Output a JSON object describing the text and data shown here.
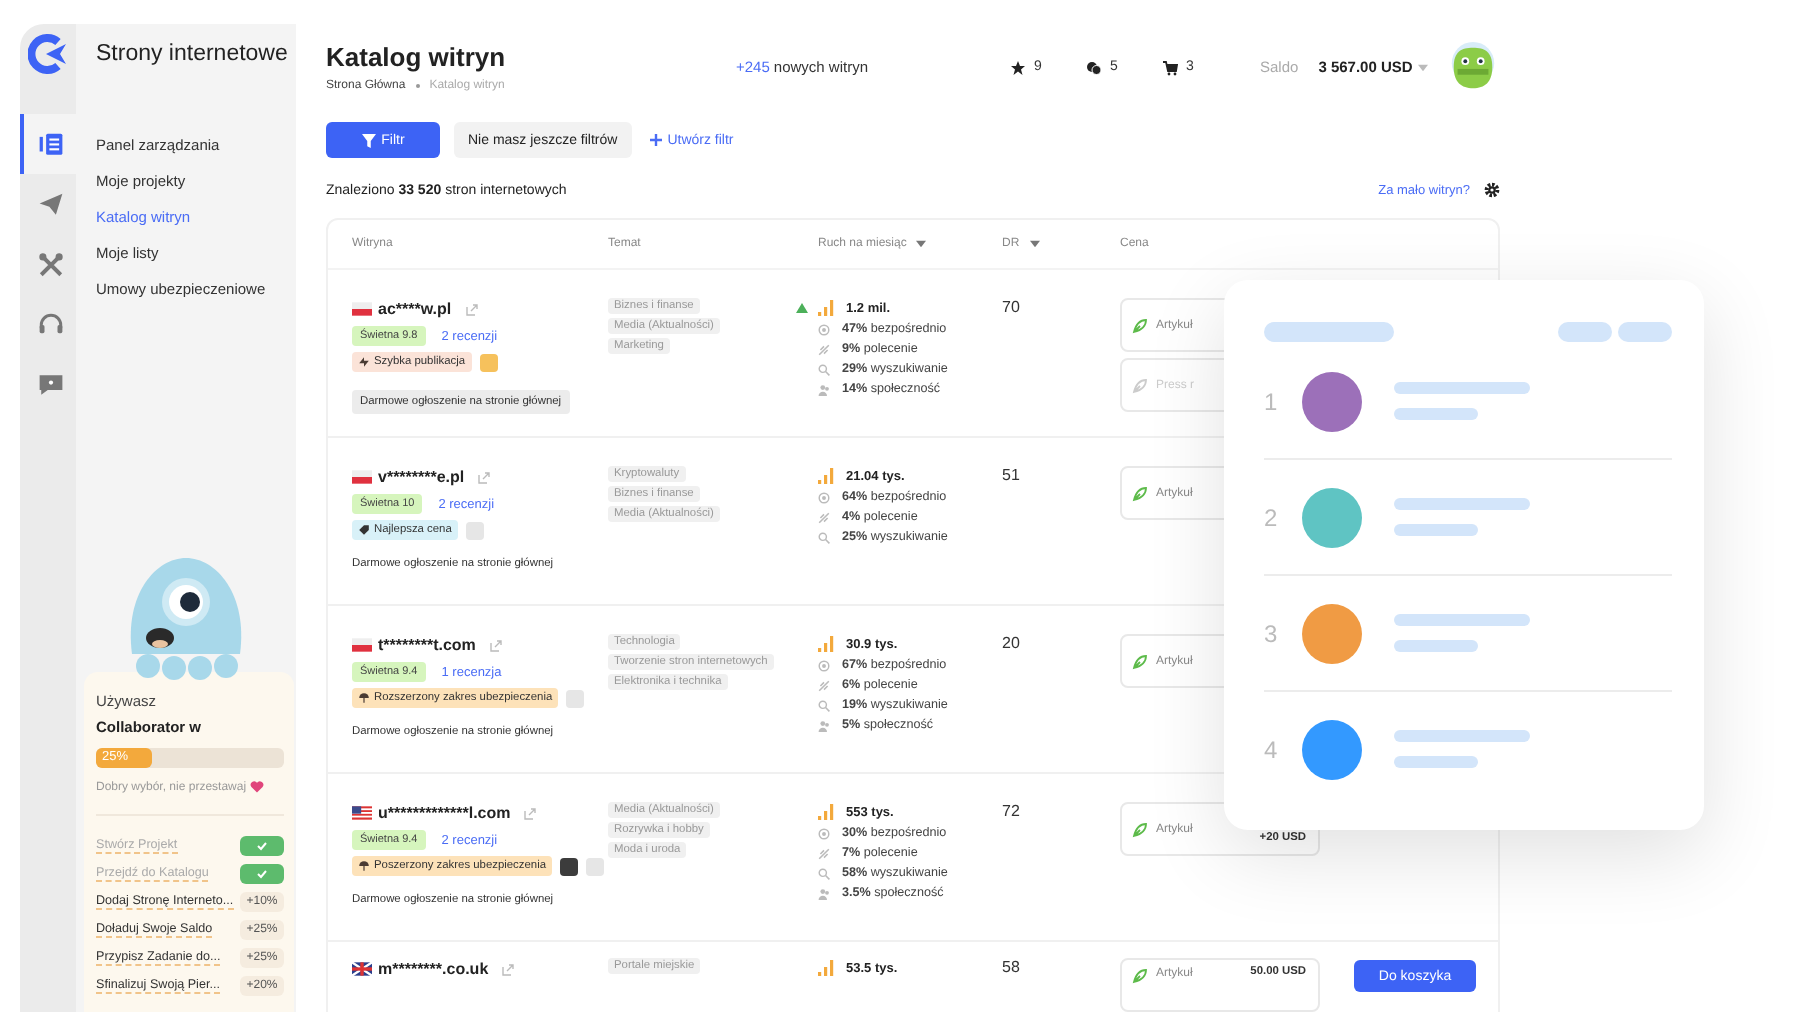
{
  "sidebar": {
    "title": "Strony internetowe",
    "rail": [
      {
        "kind": "dashboard",
        "selected": true
      },
      {
        "kind": "send",
        "selected": false
      },
      {
        "kind": "tools",
        "selected": false
      },
      {
        "kind": "support",
        "selected": false
      },
      {
        "kind": "help",
        "selected": false
      }
    ],
    "nav": [
      {
        "label": "Panel zarządzania",
        "selected": false
      },
      {
        "label": "Moje projekty",
        "selected": false
      },
      {
        "label": "Katalog witryn",
        "selected": true
      },
      {
        "label": "Moje listy",
        "selected": false
      },
      {
        "label": "Umowy ubezpieczeniowe",
        "selected": false
      }
    ],
    "onboarding": {
      "intro": "Używasz",
      "plan": "Collaborator w",
      "progress": {
        "level": 0.3,
        "label": "25%"
      },
      "message": "Dobry wybór, nie przestawaj",
      "tasks": [
        {
          "label": "Stwórz Projekt",
          "done": true
        },
        {
          "label": "Przejdź do Katalogu",
          "done": true
        },
        {
          "label": "Dodaj Stronę Interneto...",
          "done": false,
          "bonus": "+10%"
        },
        {
          "label": "Doładuj Swoje Saldo",
          "done": false,
          "bonus": "+25%"
        },
        {
          "label": "Przypisz Zadanie do...",
          "done": false,
          "bonus": "+25%"
        },
        {
          "label": "Sfinalizuj Swoją Pier...",
          "done": false,
          "bonus": "+20%"
        }
      ]
    }
  },
  "header": {
    "title": "Katalog witryn",
    "breadcrumb": [
      "Strona Główna",
      "Katalog witryn"
    ],
    "new_count": "+245",
    "new_label": "nowych witryn",
    "counters": [
      {
        "kind": "star",
        "value": "9"
      },
      {
        "kind": "chat",
        "value": "5"
      },
      {
        "kind": "cart",
        "value": "3"
      }
    ],
    "balance_label": "Saldo",
    "balance": "3 567.00 USD"
  },
  "filters": {
    "filter_button": "Filtr",
    "saved": "Nie masz jeszcze filtrów",
    "create": "Utwórz filtr"
  },
  "results": {
    "summary": "Znaleziono **33 520** stron internetowych",
    "help_link": "Za mało witryn?"
  },
  "table": {
    "columns": [
      {
        "label": "Witryna",
        "sortable": false
      },
      {
        "label": "Temat",
        "sortable": false
      },
      {
        "label": "Ruch na miesiąc",
        "sortable": true
      },
      {
        "label": "DR",
        "sortable": true
      },
      {
        "label": "Cena",
        "sortable": false
      }
    ],
    "rows": [
      {
        "flag": {
          "kind": "pl"
        },
        "domain": "ac****w.pl",
        "rating": "Świetna 9.8",
        "reviews": "2 recenzji",
        "badge": {
          "kind": "fast",
          "text": "Szybka publikacja"
        },
        "extras": [
          {
            "kind": "highlight"
          }
        ],
        "promo": {
          "text": "Darmowe ogłoszenie na stronie głównej",
          "boxed": true
        },
        "topics": [
          "Biznes i finanse",
          "Media (Aktualności)",
          "Marketing"
        ],
        "trend_up": true,
        "total": "1.2 mil.",
        "sources": [
          {
            "kind": "direct",
            "text": "**47%** bezpośrednio"
          },
          {
            "kind": "referral",
            "text": "**9%** polecenie"
          },
          {
            "kind": "search",
            "text": "**29%** wyszukiwanie"
          },
          {
            "kind": "social",
            "text": "**14%** społeczność"
          }
        ],
        "dr": "70",
        "prices": [
          {
            "label": "Artykuł",
            "disabled": false
          },
          {
            "label": "Press r",
            "disabled": true
          }
        ]
      },
      {
        "flag": {
          "kind": "pl"
        },
        "domain": "v********e.pl",
        "rating": "Świetna 10",
        "reviews": "2 recenzji",
        "badge": {
          "kind": "price",
          "text": "Najlepsza cena"
        },
        "extras": [
          {
            "kind": "comment"
          }
        ],
        "promo": {
          "text": "Darmowe ogłoszenie na stronie głównej",
          "boxed": false
        },
        "topics": [
          "Kryptowaluty",
          "Biznes i finanse",
          "Media (Aktualności)"
        ],
        "trend_up": false,
        "total": "21.04 tys.",
        "sources": [
          {
            "kind": "direct",
            "text": "**64%** bezpośrednio"
          },
          {
            "kind": "referral",
            "text": "**4%** polecenie"
          },
          {
            "kind": "search",
            "text": "**25%** wyszukiwanie"
          }
        ],
        "dr": "51",
        "prices": [
          {
            "label": "Artykuł",
            "disabled": false
          }
        ]
      },
      {
        "flag": {
          "kind": "pl"
        },
        "domain": "t********t.com",
        "rating": "Świetna 9.4",
        "reviews": "1 recenzja",
        "badge": {
          "kind": "insurance",
          "text": "Rozszerzony zakres ubezpieczenia"
        },
        "extras": [
          {
            "kind": "comment"
          }
        ],
        "promo": {
          "text": "Darmowe ogłoszenie na stronie głównej",
          "boxed": false
        },
        "topics": [
          "Technologia",
          "Tworzenie stron internetowych",
          "Elektronika i technika"
        ],
        "trend_up": false,
        "total": "30.9 tys.",
        "sources": [
          {
            "kind": "direct",
            "text": "**67%** bezpośrednio"
          },
          {
            "kind": "referral",
            "text": "**6%** polecenie"
          },
          {
            "kind": "search",
            "text": "**19%** wyszukiwanie"
          },
          {
            "kind": "social",
            "text": "**5%** społeczność"
          }
        ],
        "dr": "20",
        "prices": [
          {
            "label": "Artykuł",
            "disabled": false
          }
        ]
      },
      {
        "flag": {
          "kind": "us"
        },
        "domain": "u*************l.com",
        "rating": "Świetna 9.4",
        "reviews": "2 recenzji",
        "badge": {
          "kind": "insurance",
          "text": "Poszerzony zakres ubezpieczenia"
        },
        "extras": [
          {
            "kind": "dark"
          },
          {
            "kind": "comment"
          }
        ],
        "promo": {
          "text": "Darmowe ogłoszenie na stronie głównej",
          "boxed": false
        },
        "topics": [
          "Media (Aktualności)",
          "Rozrywka i hobby",
          "Moda i uroda"
        ],
        "trend_up": false,
        "total": "553 tys.",
        "sources": [
          {
            "kind": "direct",
            "text": "**30%** bezpośrednio"
          },
          {
            "kind": "referral",
            "text": "**7%** polecenie"
          },
          {
            "kind": "search",
            "text": "**58%** wyszukiwanie"
          },
          {
            "kind": "social",
            "text": "**3.5%** społeczność"
          }
        ],
        "dr": "72",
        "prices": [
          {
            "label": "Artykuł",
            "amount": "+20 USD",
            "disabled": false
          }
        ]
      },
      {
        "flag": {
          "kind": "gb"
        },
        "domain": "m********.co.uk",
        "extras": [],
        "topics": [
          "Portale miejskie"
        ],
        "trend_up": false,
        "total": "53.5 tys.",
        "sources": [],
        "dr": "58",
        "prices": [
          {
            "label": "Artykuł",
            "amount": "50.00 USD",
            "disabled": false
          }
        ],
        "cart_button": "Do koszyka"
      }
    ]
  },
  "overlay": {
    "items": [
      {
        "number": "1",
        "color": "#9c70b9"
      },
      {
        "number": "2",
        "color": "#5fc4c3"
      },
      {
        "number": "3",
        "color": "#f09b44"
      },
      {
        "number": "4",
        "color": "#3399ff"
      }
    ]
  }
}
